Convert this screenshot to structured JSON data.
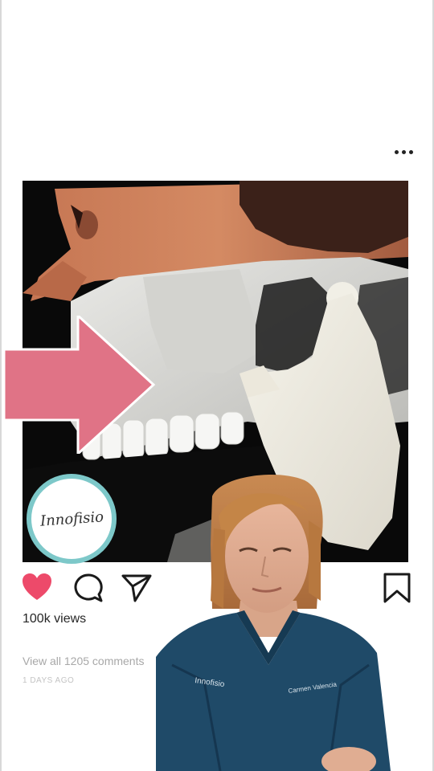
{
  "post": {
    "views": "100k views",
    "comments_link": "View all 1205 comments",
    "timestamp": "1 DAYS AGO"
  },
  "media": {
    "logo_text": "Innofisio",
    "arrow_color": "#e07386"
  },
  "overlay": {
    "scrub_text_left": "Innofisio",
    "scrub_text_right": "Carmen Valencia"
  },
  "icons": {
    "more": "more-horizontal-icon",
    "like": "heart-icon",
    "comment": "comment-bubble-icon",
    "share": "send-icon",
    "save": "bookmark-icon"
  },
  "colors": {
    "like": "#ed4a6a",
    "scrubs": "#1f4a68",
    "arrow": "#e07386",
    "logo_ring": "#7dc8c9"
  }
}
